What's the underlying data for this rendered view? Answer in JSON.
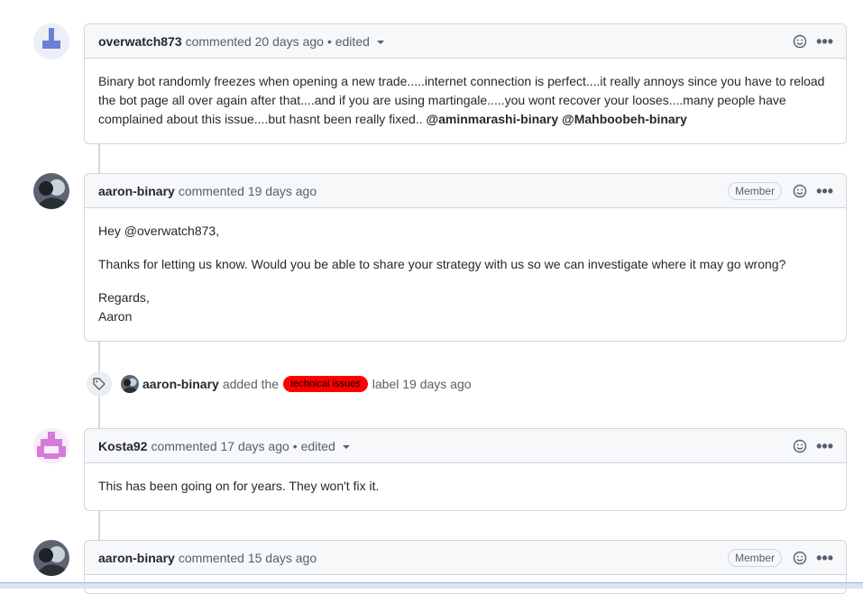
{
  "comments": [
    {
      "author": "overwatch873",
      "meta": "commented 20 days ago",
      "edited": "• edited",
      "body": [
        "Binary bot randomly freezes when opening a new trade.....internet connection is perfect....it really annoys since you have to reload the bot page all over again after that....and if you are using martingale.....you wont recover your looses....many people have complained about this issue....but hasnt been really fixed.."
      ],
      "mentions": [
        "@aminmarashi-binary",
        "@Mahboobeh-binary"
      ]
    },
    {
      "author": "aaron-binary",
      "meta": "commented 19 days ago",
      "badge": "Member",
      "greeting": "Hey",
      "greeting_mention": "@overwatch873",
      "greeting_suffix": ",",
      "body": [
        "Thanks for letting us know. Would you be able to share your strategy with us so we can investigate where it may go wrong?",
        "Regards,",
        "Aaron"
      ]
    },
    {
      "author": "Kosta92",
      "meta": "commented 17 days ago",
      "edited": "• edited",
      "body": [
        "This has been going on for years. They won't fix it."
      ]
    },
    {
      "author": "aaron-binary",
      "meta": "commented 15 days ago",
      "badge": "Member"
    }
  ],
  "event": {
    "actor": "aaron-binary",
    "action": "added the",
    "label": "technical issues",
    "suffix": "label 19 days ago",
    "label_color": "#ff0000"
  },
  "icons": {
    "emoji": "smiley-icon",
    "menu": "kebab-horizontal-icon",
    "tag": "tag-icon"
  },
  "kebab_glyph": "•••"
}
